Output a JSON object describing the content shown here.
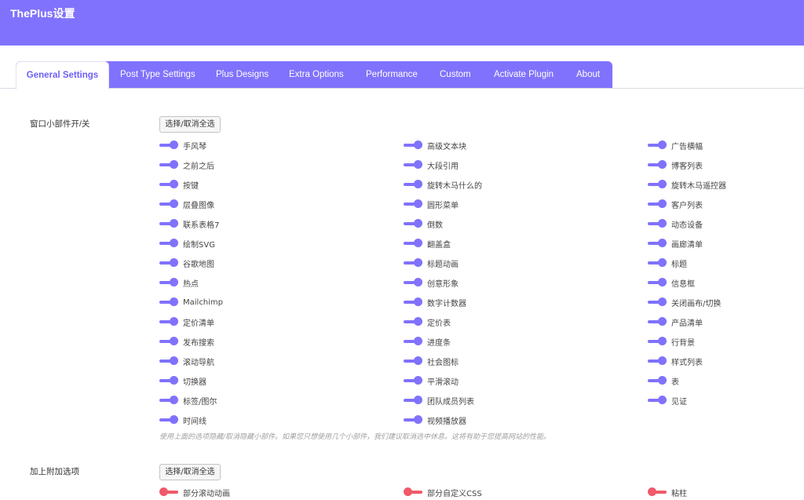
{
  "app": {
    "title": "ThePlus设置"
  },
  "tabs": [
    {
      "label": "General Settings",
      "active": true
    },
    {
      "label": "Post Type Settings"
    },
    {
      "label": "Plus Designs"
    },
    {
      "label": "Extra Options"
    },
    {
      "label": "Performance"
    },
    {
      "label": "Custom"
    },
    {
      "label": "Activate Plugin"
    },
    {
      "label": "About"
    }
  ],
  "widgets": {
    "label": "窗口小部件开/关",
    "select_all_label": "选择/取消全选",
    "columns": [
      [
        "手风琴",
        "之前之后",
        "按键",
        "层叠图像",
        "联系表格7",
        "绘制SVG",
        "谷歌地图",
        "热点",
        "Mailchimp",
        "定价清单",
        "发布搜索",
        "滚动导航",
        "切换器",
        "标签/图尔",
        "时间线"
      ],
      [
        "高级文本块",
        "大段引用",
        "旋转木马什么的",
        "圆形菜单",
        "倒数",
        "翻盖盒",
        "标题动画",
        "创意形象",
        "数字计数器",
        "定价表",
        "进度条",
        "社会图标",
        "平滑滚动",
        "团队成员列表",
        "视频播放器"
      ],
      [
        "广告横幅",
        "博客列表",
        "旋转木马遥控器",
        "客户列表",
        "动态设备",
        "画廊清单",
        "标题",
        "信息框",
        "关闭画布/切换",
        "产品清单",
        "行背景",
        "样式列表",
        "表",
        "见证"
      ]
    ],
    "state": "on",
    "hint": "使用上面的选项隐藏/取消隐藏小部件。如果您只想使用几个小部件，我们建议取消选中休息。这将有助于您提高网站的性能。"
  },
  "extras": {
    "label": "加上附加选项",
    "select_all_label": "选择/取消全选",
    "items": [
      "部分滚动动画",
      "部分自定义CSS",
      "粘柱"
    ],
    "state": "off"
  },
  "colors": {
    "accent": "#8072fc",
    "toggle_on": "#8072fc",
    "toggle_off": "#f05a6a"
  }
}
